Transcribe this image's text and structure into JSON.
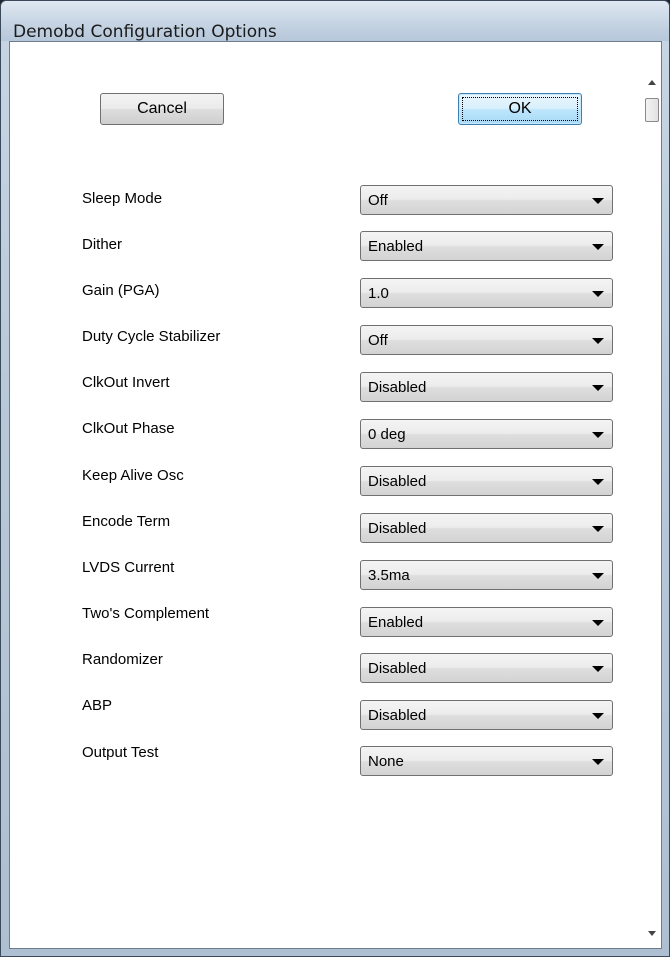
{
  "window": {
    "title": "Demobd Configuration Options"
  },
  "buttons": {
    "cancel_label": "Cancel",
    "ok_label": "OK"
  },
  "options": [
    {
      "label": "Sleep Mode",
      "value": "Off"
    },
    {
      "label": "Dither",
      "value": "Enabled"
    },
    {
      "label": "Gain (PGA)",
      "value": "1.0"
    },
    {
      "label": "Duty Cycle Stabilizer",
      "value": "Off"
    },
    {
      "label": "ClkOut Invert",
      "value": "Disabled"
    },
    {
      "label": "ClkOut Phase",
      "value": "0 deg"
    },
    {
      "label": "Keep Alive Osc",
      "value": "Disabled"
    },
    {
      "label": "Encode Term",
      "value": "Disabled"
    },
    {
      "label": "LVDS Current",
      "value": "3.5ma"
    },
    {
      "label": "Two's Complement",
      "value": "Enabled"
    },
    {
      "label": "Randomizer",
      "value": "Disabled"
    },
    {
      "label": "ABP",
      "value": "Disabled"
    },
    {
      "label": "Output Test",
      "value": "None"
    }
  ],
  "icons": {
    "dropdown": "chevron-down-icon",
    "scroll_up": "scroll-up-arrow-icon",
    "scroll_down": "scroll-down-arrow-icon"
  }
}
